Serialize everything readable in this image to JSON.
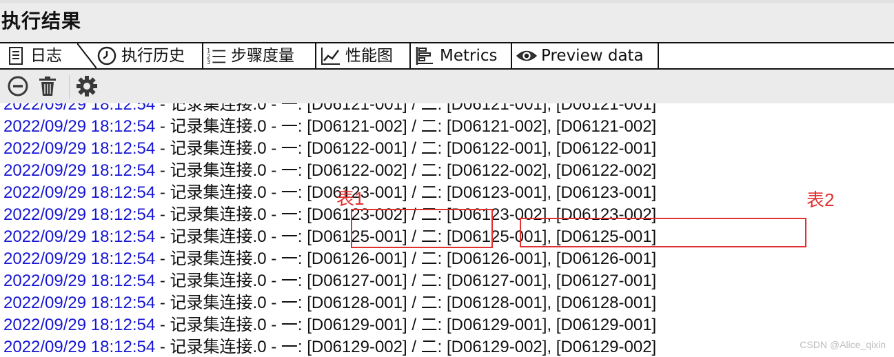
{
  "panel": {
    "title": "执行结果"
  },
  "tabs": [
    {
      "label": "日志",
      "icon": "log-document-icon",
      "active": true
    },
    {
      "label": "执行历史",
      "icon": "clock-history-icon",
      "active": false
    },
    {
      "label": "步骤度量",
      "icon": "numbered-list-icon",
      "active": false
    },
    {
      "label": "性能图",
      "icon": "line-chart-icon",
      "active": false
    },
    {
      "label": "Metrics",
      "icon": "metrics-bars-icon",
      "active": false
    },
    {
      "label": "Preview data",
      "icon": "eye-icon",
      "active": false
    }
  ],
  "toolbar": [
    {
      "icon": "stop-circle-icon"
    },
    {
      "icon": "trash-icon"
    },
    {
      "icon": "settings-gear-icon"
    }
  ],
  "log": {
    "partial_top": {
      "ts": "2022/09/29 18:12:54",
      "msg": " - 记录集连接.0 - 一: [D06121-001] / 二: [D06121-001], [D06121-001]"
    },
    "lines": [
      {
        "ts": "2022/09/29 18:12:54",
        "msg": " - 记录集连接.0 - 一: [D06121-002] / 二: [D06121-002], [D06121-002]"
      },
      {
        "ts": "2022/09/29 18:12:54",
        "msg": " - 记录集连接.0 - 一: [D06122-001] / 二: [D06122-001], [D06122-001]"
      },
      {
        "ts": "2022/09/29 18:12:54",
        "msg": " - 记录集连接.0 - 一: [D06122-002] / 二: [D06122-002], [D06122-002]"
      },
      {
        "ts": "2022/09/29 18:12:54",
        "msg": " - 记录集连接.0 - 一: [D06123-001] / 二: [D06123-001], [D06123-001]"
      },
      {
        "ts": "2022/09/29 18:12:54",
        "msg": " - 记录集连接.0 - 一: [D06123-002] / 二: [D06123-002], [D06123-002]"
      },
      {
        "ts": "2022/09/29 18:12:54",
        "msg": " - 记录集连接.0 - 一: [D06125-001] / 二: [D06125-001], [D06125-001]"
      },
      {
        "ts": "2022/09/29 18:12:54",
        "msg": " - 记录集连接.0 - 一: [D06126-001] / 二: [D06126-001], [D06126-001]"
      },
      {
        "ts": "2022/09/29 18:12:54",
        "msg": " - 记录集连接.0 - 一: [D06127-001] / 二: [D06127-001], [D06127-001]"
      },
      {
        "ts": "2022/09/29 18:12:54",
        "msg": " - 记录集连接.0 - 一: [D06128-001] / 二: [D06128-001], [D06128-001]"
      },
      {
        "ts": "2022/09/29 18:12:54",
        "msg": " - 记录集连接.0 - 一: [D06129-001] / 二: [D06129-001], [D06129-001]"
      },
      {
        "ts": "2022/09/29 18:12:54",
        "msg": " - 记录集连接.0 - 一: [D06129-002] / 二: [D06129-002], [D06129-002]"
      }
    ]
  },
  "annotations": {
    "label1": "表1",
    "label2": "表2",
    "color": "#e03030"
  },
  "watermark": "CSDN @Alice_qixin",
  "colors": {
    "timestamp": "#1515d4",
    "text": "#111111"
  }
}
